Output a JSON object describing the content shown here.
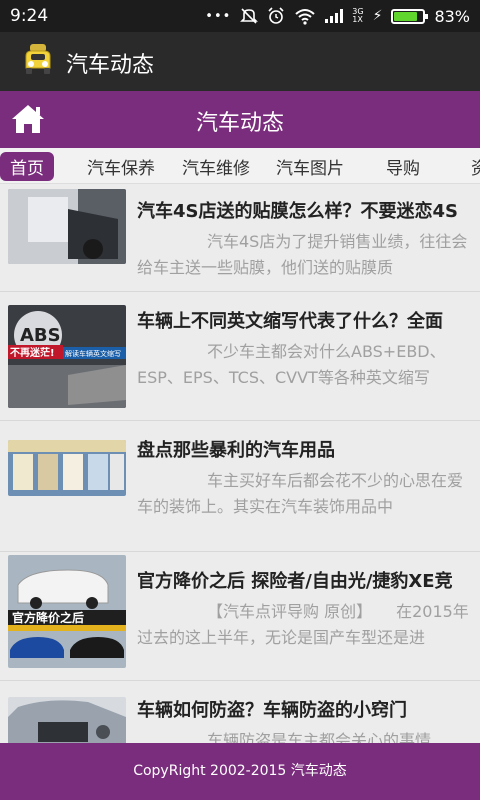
{
  "status": {
    "time": "9:24",
    "net_top": "3G",
    "net_bottom": "1X",
    "battery": "83%",
    "battery_level": 0.83,
    "dots": "•••"
  },
  "app": {
    "title": "汽车动态"
  },
  "header": {
    "title": "汽车动态"
  },
  "tabs": [
    {
      "label": "首页"
    },
    {
      "label": "汽车保养"
    },
    {
      "label": "汽车维修"
    },
    {
      "label": "汽车图片"
    },
    {
      "label": "导购"
    },
    {
      "label": "资"
    }
  ],
  "articles": [
    {
      "title": "汽车4S店送的贴膜怎么样？不要迷恋4S",
      "desc": "汽车4S店为了提升销售业绩，往往会给车主送一些贴膜，他们送的贴膜质"
    },
    {
      "title": "车辆上不同英文缩写代表了什么？全面",
      "desc": "不少车主都会对什么ABS+EBD、ESP、EPS、TCS、CVVT等各种英文缩写",
      "thumb_text": {
        "abs": "ABS",
        "badge": "不再迷茫!",
        "sub": "解读车辆英文缩写"
      }
    },
    {
      "title": "盘点那些暴利的汽车用品",
      "desc": "车主买好车后都会花不少的心思在爱车的装饰上。其实在汽车装饰用品中"
    },
    {
      "title": "官方降价之后 探险者/自由光/捷豹XE竞",
      "desc": "【汽车点评导购 原创】　　在2015年过去的这上半年，无论是国产车型还是进",
      "thumb_text": {
        "banner": "官方降价之后"
      }
    },
    {
      "title": "车辆如何防盗？车辆防盗的小窍门",
      "desc": "车辆防盗是车主都会关心的事情"
    }
  ],
  "footer": {
    "text": "CopyRight 2002-2015 汽车动态"
  },
  "colors": {
    "accent": "#7b2d7d",
    "appbar": "#2a2a2a",
    "statusbar": "#1c1c1c"
  }
}
